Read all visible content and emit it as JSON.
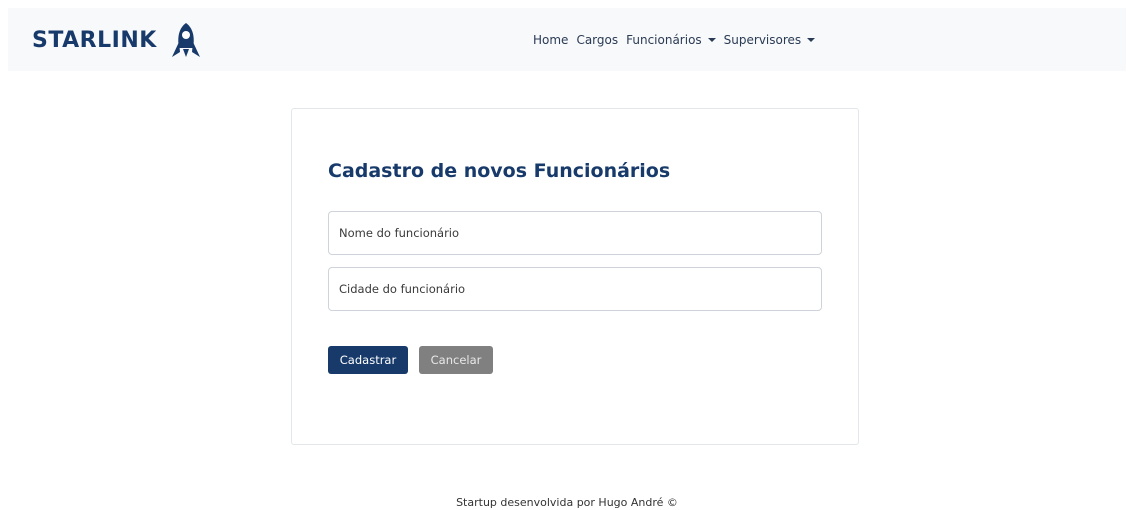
{
  "brand": {
    "name": "STARLINK",
    "logo_icon": "rocket-icon",
    "color": "#173a6b"
  },
  "nav": {
    "items": [
      {
        "label": "Home",
        "dropdown": false
      },
      {
        "label": "Cargos",
        "dropdown": false
      },
      {
        "label": "Funcionários",
        "dropdown": true
      },
      {
        "label": "Supervisores",
        "dropdown": true
      }
    ]
  },
  "form": {
    "title": "Cadastro de novos Funcionários",
    "name_field": {
      "placeholder": "Nome do funcionário",
      "value": ""
    },
    "city_field": {
      "placeholder": "Cidade do funcionário",
      "value": ""
    },
    "submit_label": "Cadastrar",
    "cancel_label": "Cancelar"
  },
  "footer": {
    "text": "Startup desenvolvida por Hugo André ©"
  },
  "colors": {
    "primary": "#173a6b",
    "secondary": "#808080",
    "navbar_bg": "#f8f9fa"
  }
}
